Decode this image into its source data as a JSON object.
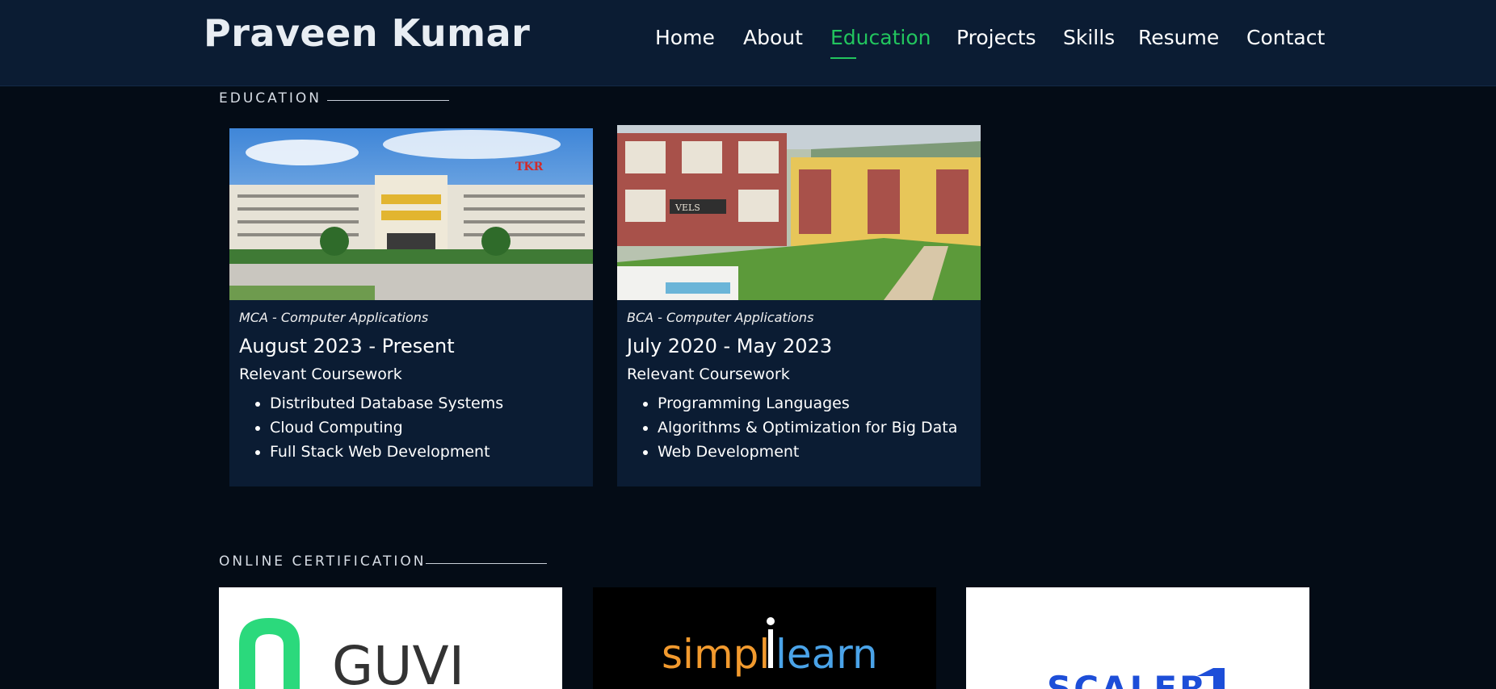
{
  "header": {
    "brand": "Praveen Kumar",
    "nav": [
      "Home",
      "About",
      "Education",
      "Projects",
      "Skills",
      "Resume",
      "Contact"
    ],
    "active": "Education",
    "accent_color": "#22c55e"
  },
  "education": {
    "title": "EDUCATION",
    "cards": [
      {
        "degree": "MCA - Computer Applications",
        "dates": "August 2023 - Present",
        "coursework_label": "Relevant Coursework",
        "courses": [
          "Distributed Database Systems",
          "Cloud Computing",
          "Full Stack Web Development"
        ],
        "photo_logo": "TKR"
      },
      {
        "degree": "BCA - Computer Applications",
        "dates": "July 2020 - May 2023",
        "coursework_label": "Relevant Coursework",
        "courses": [
          "Programming Languages",
          "Algorithms & Optimization for Big Data",
          "Web Development"
        ],
        "photo_sign": "VELS"
      }
    ]
  },
  "certification": {
    "title": "ONLINE CERTIFICATION",
    "logos": [
      {
        "name": "GUVI",
        "color": "#333333",
        "mark_color": "#2bd97c"
      },
      {
        "name_left": "simpl",
        "name_right": "learn",
        "left_color": "#f29a2e",
        "right_color": "#4aa3e8"
      },
      {
        "name": "SCALER",
        "color": "#1d4ed8"
      }
    ]
  }
}
